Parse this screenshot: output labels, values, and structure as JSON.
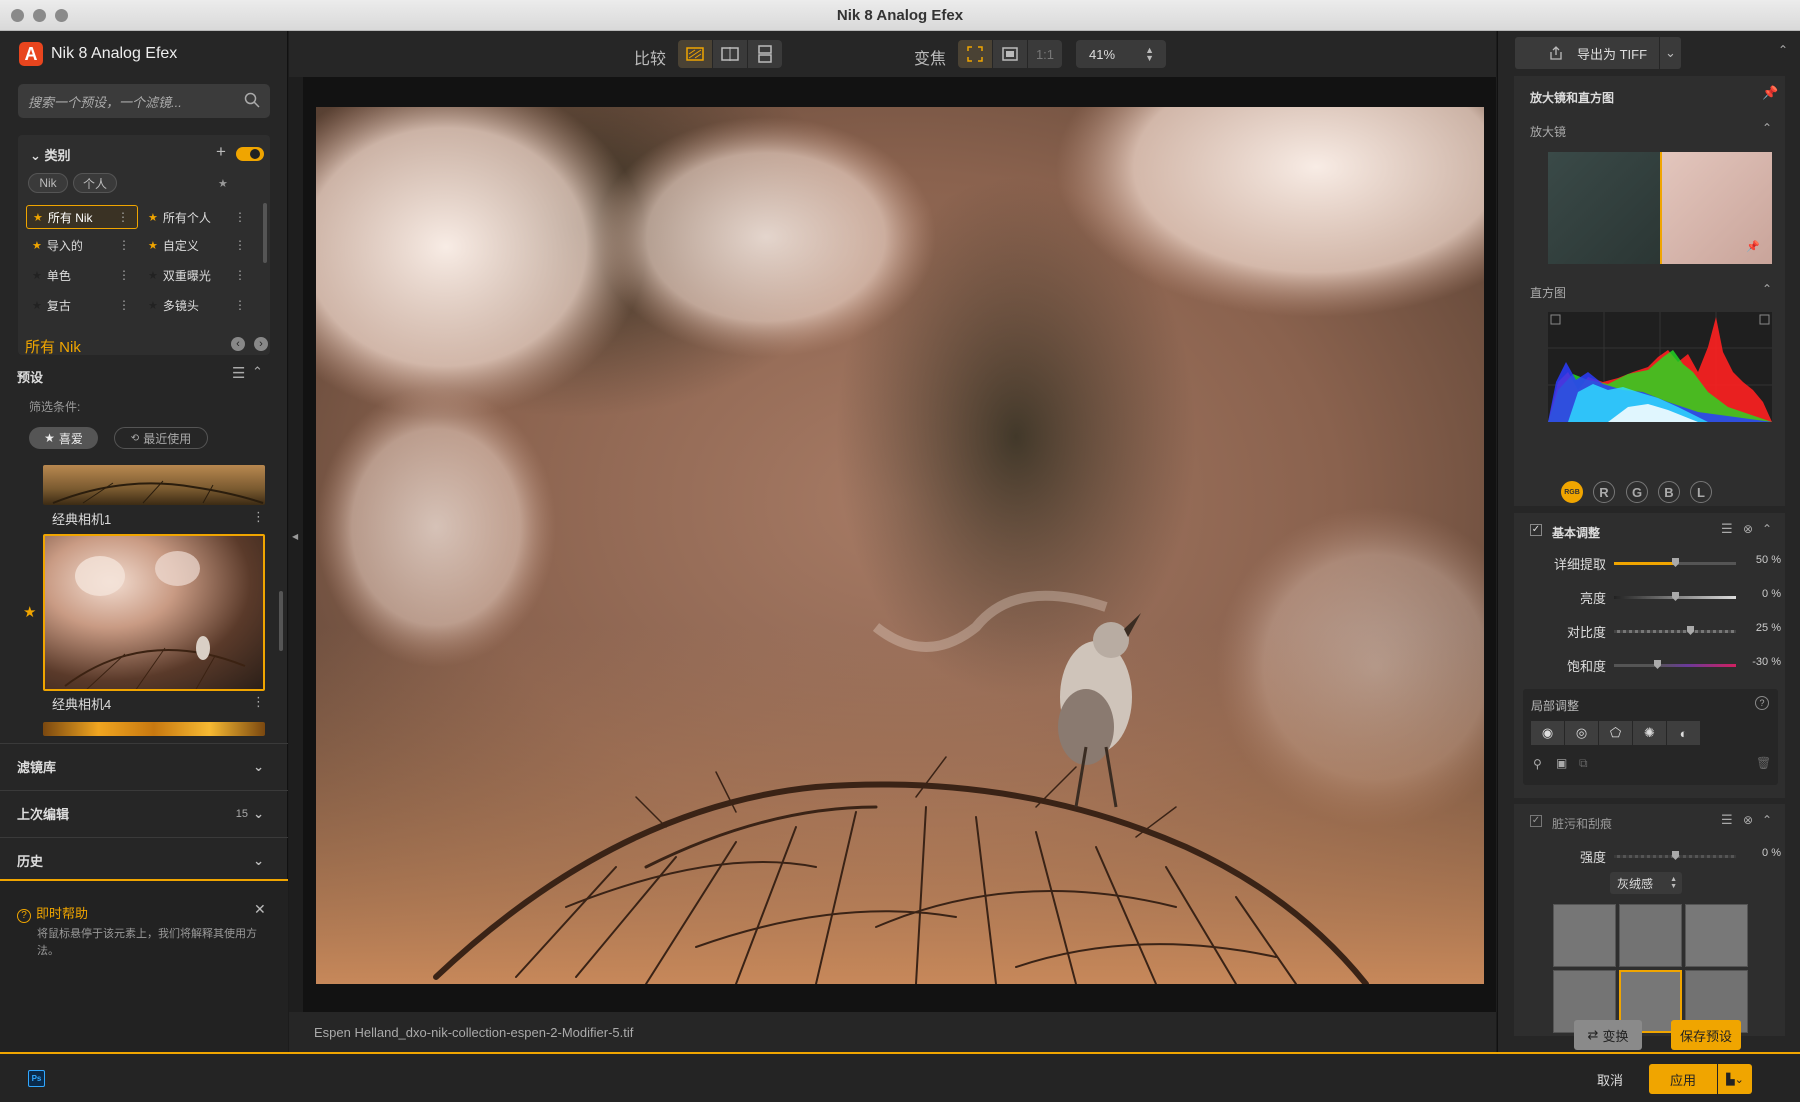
{
  "window": {
    "title": "Nik 8 Analog Efex"
  },
  "app": {
    "name": "Nik 8 Analog Efex"
  },
  "search": {
    "placeholder": "搜索一个预设，一个滤镜..."
  },
  "categories": {
    "header": "类别",
    "chips": [
      "Nik",
      "个人"
    ],
    "items": [
      {
        "label": "所有 Nik",
        "selected": true
      },
      {
        "label": "所有个人"
      },
      {
        "label": "导入的"
      },
      {
        "label": "自定义"
      },
      {
        "label": "单色"
      },
      {
        "label": "双重曝光"
      },
      {
        "label": "复古"
      },
      {
        "label": "多镜头"
      }
    ]
  },
  "current_category": "所有 Nik",
  "presets": {
    "header": "预设",
    "filter_label": "筛选条件:",
    "filters": [
      "喜爱",
      "最近使用"
    ],
    "items": [
      {
        "label": "经典相机1"
      },
      {
        "label": "经典相机4",
        "selected": true
      }
    ]
  },
  "accordions": [
    {
      "label": "滤镜库",
      "count": ""
    },
    {
      "label": "上次编辑",
      "count": "15"
    },
    {
      "label": "历史",
      "count": ""
    }
  ],
  "help": {
    "title": "即时帮助",
    "text": "将鼠标悬停于该元素上，我们将解释其使用方法。"
  },
  "toolbar": {
    "compare_label": "比较",
    "zoom_label": "变焦",
    "one_to_one": "1:1",
    "zoom_value": "41%"
  },
  "file": {
    "name": "Espen Helland_dxo-nik-collection-espen-2-Modifier-5.tif"
  },
  "right": {
    "export_label": "导出为 TIFF",
    "loupe_histogram_title": "放大镜和直方图",
    "loupe_label": "放大镜",
    "histogram_label": "直方图",
    "channels": [
      "RGB",
      "R",
      "G",
      "B",
      "L"
    ],
    "basic": {
      "title": "基本调整",
      "sliders": [
        {
          "label": "详细提取",
          "value": "50 %",
          "level": 0.5
        },
        {
          "label": "亮度",
          "value": "0 %",
          "level": 0.5
        },
        {
          "label": "对比度",
          "value": "25 %",
          "level": 0.62
        },
        {
          "label": "饱和度",
          "value": "-30 %",
          "level": 0.35
        }
      ]
    },
    "local": {
      "title": "局部调整"
    },
    "dirt": {
      "title": "脏污和刮痕",
      "strength_label": "强度",
      "strength_value": "0 %",
      "type_value": "灰绒感"
    },
    "swap_label": "变换",
    "save_preset_label": "保存预设"
  },
  "bottom": {
    "ps_badge": "Ps",
    "cancel_label": "取消",
    "apply_label": "应用"
  },
  "colors": {
    "accent": "#f0a500"
  }
}
